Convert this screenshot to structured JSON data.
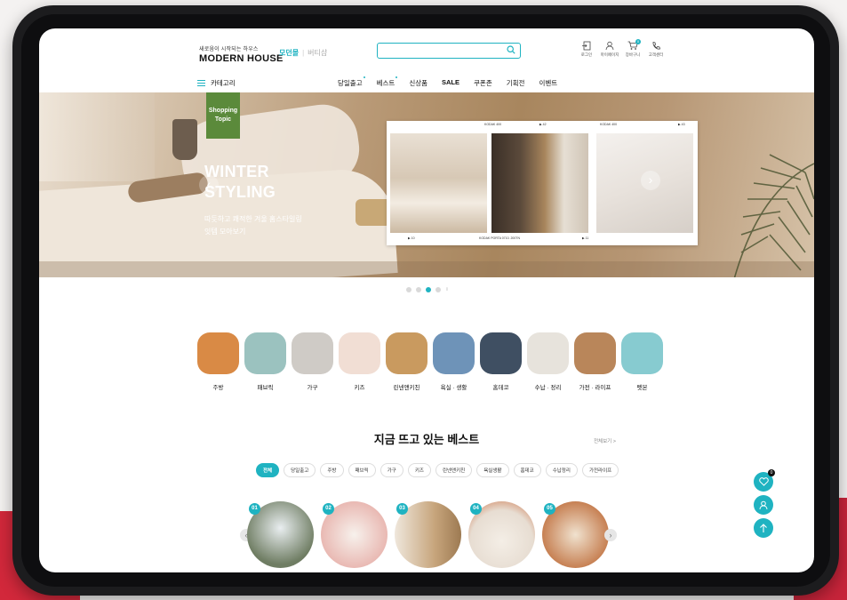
{
  "brand": {
    "tagline": "새로움이 시작되는 하우스",
    "name": "MODERN HOUSE"
  },
  "shop_tabs": {
    "active": "모던몰",
    "other": "버티샵"
  },
  "search": {
    "placeholder": ""
  },
  "utilities": [
    {
      "label": "로그인",
      "icon": "login-icon"
    },
    {
      "label": "마이페이지",
      "icon": "user-icon"
    },
    {
      "label": "장바구니",
      "icon": "cart-icon",
      "badge": "0"
    },
    {
      "label": "고객센터",
      "icon": "phone-icon"
    }
  ],
  "nav": {
    "category_label": "카테고리",
    "items": [
      "당일출고",
      "베스트",
      "신상품",
      "SALE",
      "쿠폰존",
      "기획전",
      "이벤트"
    ]
  },
  "banner": {
    "badge": "Shopping Topic",
    "title_line1": "WINTER",
    "title_line2": "STYLING",
    "sub_line1": "따듯하고 쾌적한 겨울 홈스타일링",
    "sub_line2": "잇템 모아보기",
    "collage_top": [
      "KODAK 400",
      "▶ 42",
      "KODAK 400",
      "▶ 43"
    ],
    "collage_bottom": [
      "▶ 10",
      "KODAK PORTA 0710. 200TN",
      "▶ 11"
    ],
    "slides_total": 4,
    "slide_current": 3
  },
  "categories": [
    {
      "label": "주방",
      "color": "#d98a45"
    },
    {
      "label": "패브릭",
      "color": "#9bc2bf"
    },
    {
      "label": "가구",
      "color": "#cfcbc6"
    },
    {
      "label": "키즈",
      "color": "#f1ded4"
    },
    {
      "label": "린넨앤키친",
      "color": "#c99a5f"
    },
    {
      "label": "욕실 · 생활",
      "color": "#6e93b8"
    },
    {
      "label": "홈데코",
      "color": "#3f4f62"
    },
    {
      "label": "수납 · 정리",
      "color": "#e7e3dc"
    },
    {
      "label": "가전 · 라이프",
      "color": "#b9865a"
    },
    {
      "label": "펫본",
      "color": "#87cbd0"
    }
  ],
  "best": {
    "title": "지금 뜨고 있는 베스트",
    "more": "전체보기 >",
    "filters": [
      "전체",
      "당일출고",
      "주방",
      "패브릭",
      "가구",
      "키즈",
      "린넨앤키친",
      "욕실생활",
      "홈데코",
      "수납정리",
      "가전라이프"
    ],
    "products": [
      {
        "rank": "01",
        "color": "#6f7d63"
      },
      {
        "rank": "02",
        "color": "#e9b9b3"
      },
      {
        "rank": "03",
        "color": "#c7a57c"
      },
      {
        "rank": "04",
        "color": "#e7ddd2"
      },
      {
        "rank": "05",
        "color": "#c47a4b"
      }
    ]
  },
  "floating": {
    "wish_count": "0"
  },
  "colors": {
    "accent": "#1fb3c1",
    "topic_badge": "#5b8a3b"
  }
}
